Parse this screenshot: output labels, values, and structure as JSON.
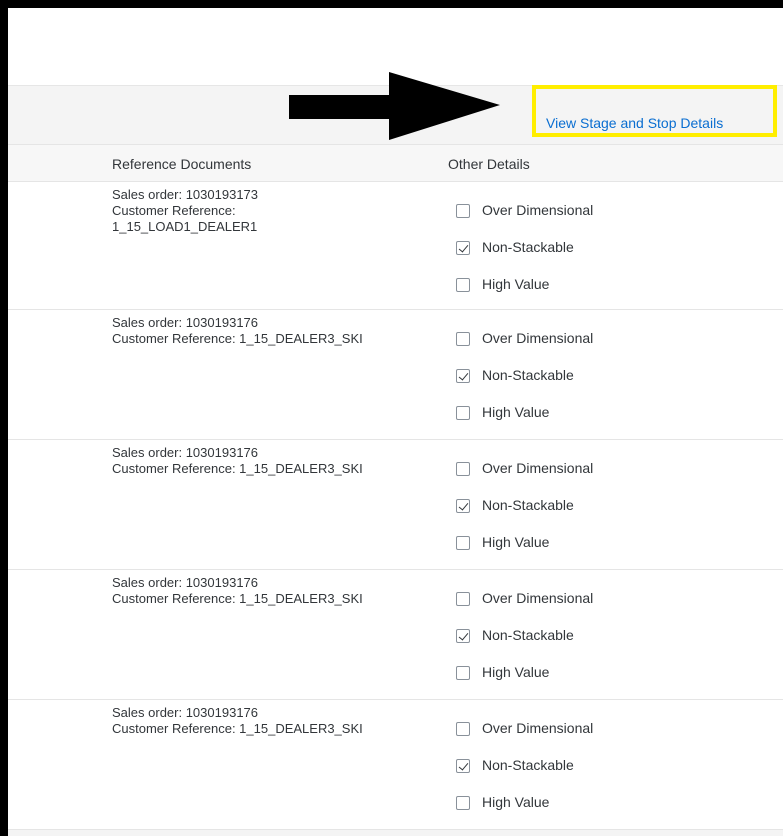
{
  "toolbar": {
    "link_label": "View Stage and Stop Details"
  },
  "table": {
    "columns": {
      "reference": "Reference Documents",
      "other": "Other Details"
    },
    "rows": [
      {
        "ref_lines": [
          "Sales order: 1030193173",
          "Customer Reference:",
          "1_15_LOAD1_DEALER1"
        ],
        "options": [
          {
            "label": "Over Dimensional",
            "checked": false
          },
          {
            "label": "Non-Stackable",
            "checked": true
          },
          {
            "label": "High Value",
            "checked": false
          }
        ]
      },
      {
        "ref_lines": [
          "Sales order: 1030193176",
          "Customer Reference: 1_15_DEALER3_SKI"
        ],
        "options": [
          {
            "label": "Over Dimensional",
            "checked": false
          },
          {
            "label": "Non-Stackable",
            "checked": true
          },
          {
            "label": "High Value",
            "checked": false
          }
        ]
      },
      {
        "ref_lines": [
          "Sales order: 1030193176",
          "Customer Reference: 1_15_DEALER3_SKI"
        ],
        "options": [
          {
            "label": "Over Dimensional",
            "checked": false
          },
          {
            "label": "Non-Stackable",
            "checked": true
          },
          {
            "label": "High Value",
            "checked": false
          }
        ]
      },
      {
        "ref_lines": [
          "Sales order: 1030193176",
          "Customer Reference: 1_15_DEALER3_SKI"
        ],
        "options": [
          {
            "label": "Over Dimensional",
            "checked": false
          },
          {
            "label": "Non-Stackable",
            "checked": true
          },
          {
            "label": "High Value",
            "checked": false
          }
        ]
      },
      {
        "ref_lines": [
          "Sales order: 1030193176",
          "Customer Reference: 1_15_DEALER3_SKI"
        ],
        "options": [
          {
            "label": "Over Dimensional",
            "checked": false
          },
          {
            "label": "Non-Stackable",
            "checked": true
          },
          {
            "label": "High Value",
            "checked": false
          }
        ]
      }
    ]
  },
  "colors": {
    "link": "#0a6ed1",
    "highlight": "#ffee00",
    "arrow": "#000000",
    "text": "#32363a"
  },
  "annotations": {
    "arrow_icon": "right-arrow-icon",
    "highlight": "highlight-box"
  }
}
